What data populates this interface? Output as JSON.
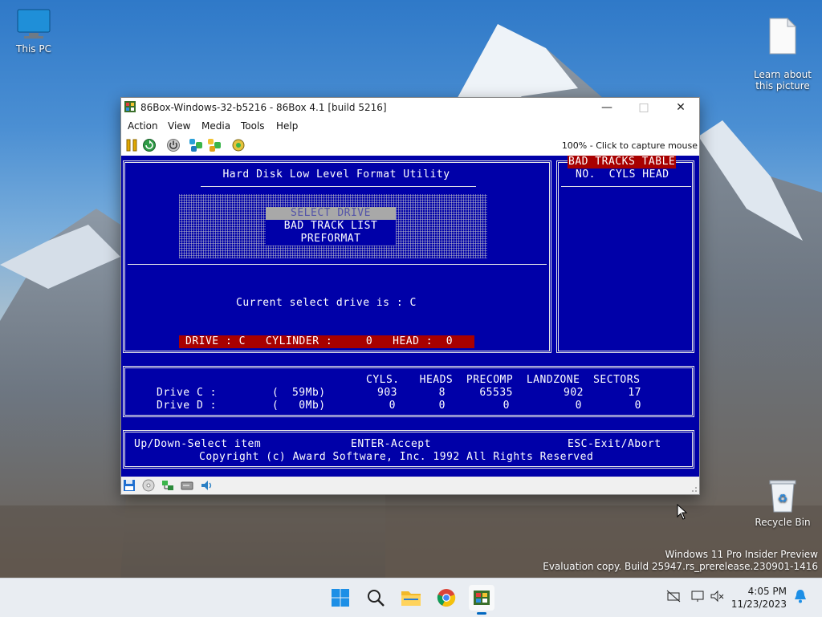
{
  "desktop": {
    "icons": {
      "this_pc": "This PC",
      "learn": "Learn about\nthis picture",
      "recycle": "Recycle Bin"
    },
    "watermark": {
      "line1": "Windows 11 Pro Insider Preview",
      "line2": "Evaluation copy. Build 25947.rs_prerelease.230901-1416"
    }
  },
  "window": {
    "title": "86Box-Windows-32-b5216 - 86Box 4.1 [build 5216]",
    "menu": [
      "Action",
      "View",
      "Media",
      "Tools",
      "Help"
    ],
    "capture_text": "100% - Click to capture mouse",
    "toolbar_icons": [
      "pause-icon",
      "reset-icon",
      "power-icon",
      "ctrl-alt-del-icon",
      "ctrl-alt-esc-icon",
      "settings-icon"
    ],
    "status_icons": [
      "floppy-icon",
      "cdrom-icon",
      "network-icon",
      "hdd-icon",
      "sound-icon"
    ]
  },
  "dos": {
    "title": "Hard Disk Low Level Format Utility",
    "menu_items": [
      "SELECT DRIVE",
      "BAD TRACK LIST",
      "PREFORMAT"
    ],
    "selected_index": 0,
    "current_drive": "Current select drive is : C",
    "status_bar": "DRIVE : C   CYLINDER :     0   HEAD :  0",
    "bad_tracks": {
      "title": "BAD TRACKS TABLE",
      "header": "NO.  CYLS HEAD"
    },
    "drive_table": {
      "header": "CYLS.   HEADS  PRECOMP  LANDZONE  SECTORS",
      "rows": [
        {
          "label": "Drive C :",
          "size": "(  59Mb)",
          "cyls": "903",
          "heads": "8",
          "precomp": "65535",
          "landzone": "902",
          "sectors": "17"
        },
        {
          "label": "Drive D :",
          "size": "(   0Mb)",
          "cyls": "0",
          "heads": "0",
          "precomp": "0",
          "landzone": "0",
          "sectors": "0"
        }
      ]
    },
    "help": {
      "left": "Up/Down-Select item",
      "center": "ENTER-Accept",
      "right": "ESC-Exit/Abort",
      "copyright": "Copyright (c) Award Software, Inc. 1992 All Rights Reserved"
    }
  },
  "taskbar": {
    "apps": [
      "start-icon",
      "search-icon",
      "file-explorer-icon",
      "chrome-icon",
      "86box-icon"
    ],
    "time": "4:05 PM",
    "date": "11/23/2023"
  }
}
